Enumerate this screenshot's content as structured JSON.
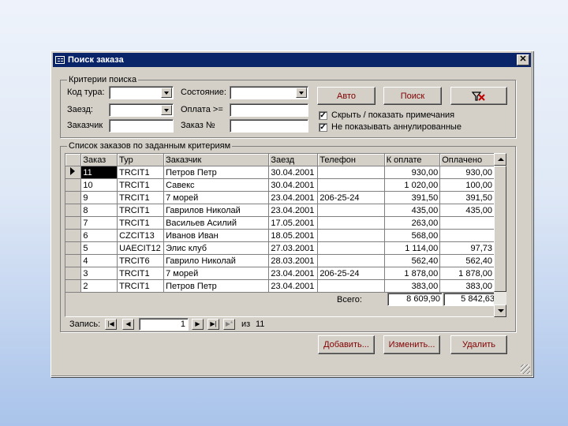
{
  "window": {
    "title": "Поиск заказа",
    "close_glyph": "✕"
  },
  "criteria": {
    "title": "Критерии поиска",
    "tour_code_label": "Код тура:",
    "state_label": "Состояние:",
    "arrival_label": "Заезд:",
    "payment_label": "Оплата >=",
    "customer_label": "Заказчик",
    "order_no_label": "Заказ №",
    "auto_button": "Авто",
    "search_button": "Поиск",
    "show_notes_label": "Скрыть / показать примечания",
    "hide_cancelled_label": "Не показывать аннулированные",
    "show_notes_checked": "✓",
    "hide_cancelled_checked": "✓"
  },
  "list": {
    "title": "Список заказов по заданным критериям",
    "columns": [
      "Заказ",
      "Тур",
      "Заказчик",
      "Заезд",
      "Телефон",
      "К оплате",
      "Оплачено"
    ],
    "rows": [
      [
        "11",
        "TRCIT1",
        "Петров Петр",
        "30.04.2001",
        "",
        "930,00",
        "930,00"
      ],
      [
        "10",
        "TRCIT1",
        "Савекс",
        "30.04.2001",
        "",
        "1 020,00",
        "100,00"
      ],
      [
        "9",
        "TRCIT1",
        "7 морей",
        "23.04.2001",
        "206-25-24",
        "391,50",
        "391,50"
      ],
      [
        "8",
        "TRCIT1",
        "Гаврилов Николай",
        "23.04.2001",
        "",
        "435,00",
        "435,00"
      ],
      [
        "7",
        "TRCIT1",
        "Васильев Асилий",
        "17.05.2001",
        "",
        "263,00",
        ""
      ],
      [
        "6",
        "CZCIT13",
        "Иванов Иван",
        "18.05.2001",
        "",
        "568,00",
        ""
      ],
      [
        "5",
        "UAECIT12",
        "Элис клуб",
        "27.03.2001",
        "",
        "1 114,00",
        "97,73"
      ],
      [
        "4",
        "TRCIT6",
        "Гаврило Николай",
        "28.03.2001",
        "",
        "562,40",
        "562,40"
      ],
      [
        "3",
        "TRCIT1",
        "7 морей",
        "23.04.2001",
        "206-25-24",
        "1 878,00",
        "1 878,00"
      ],
      [
        "2",
        "TRCIT1",
        "Петров Петр",
        "23.04.2001",
        "",
        "383,00",
        "383,00"
      ]
    ],
    "total_label": "Всего:",
    "total_due": "8 609,90",
    "total_paid": "5 842,63"
  },
  "navigator": {
    "record_label": "Запись:",
    "current": "1",
    "of_label": "из",
    "count": "11"
  },
  "actions": {
    "add": "Добавить...",
    "edit": "Изменить...",
    "delete": "Удалить"
  }
}
